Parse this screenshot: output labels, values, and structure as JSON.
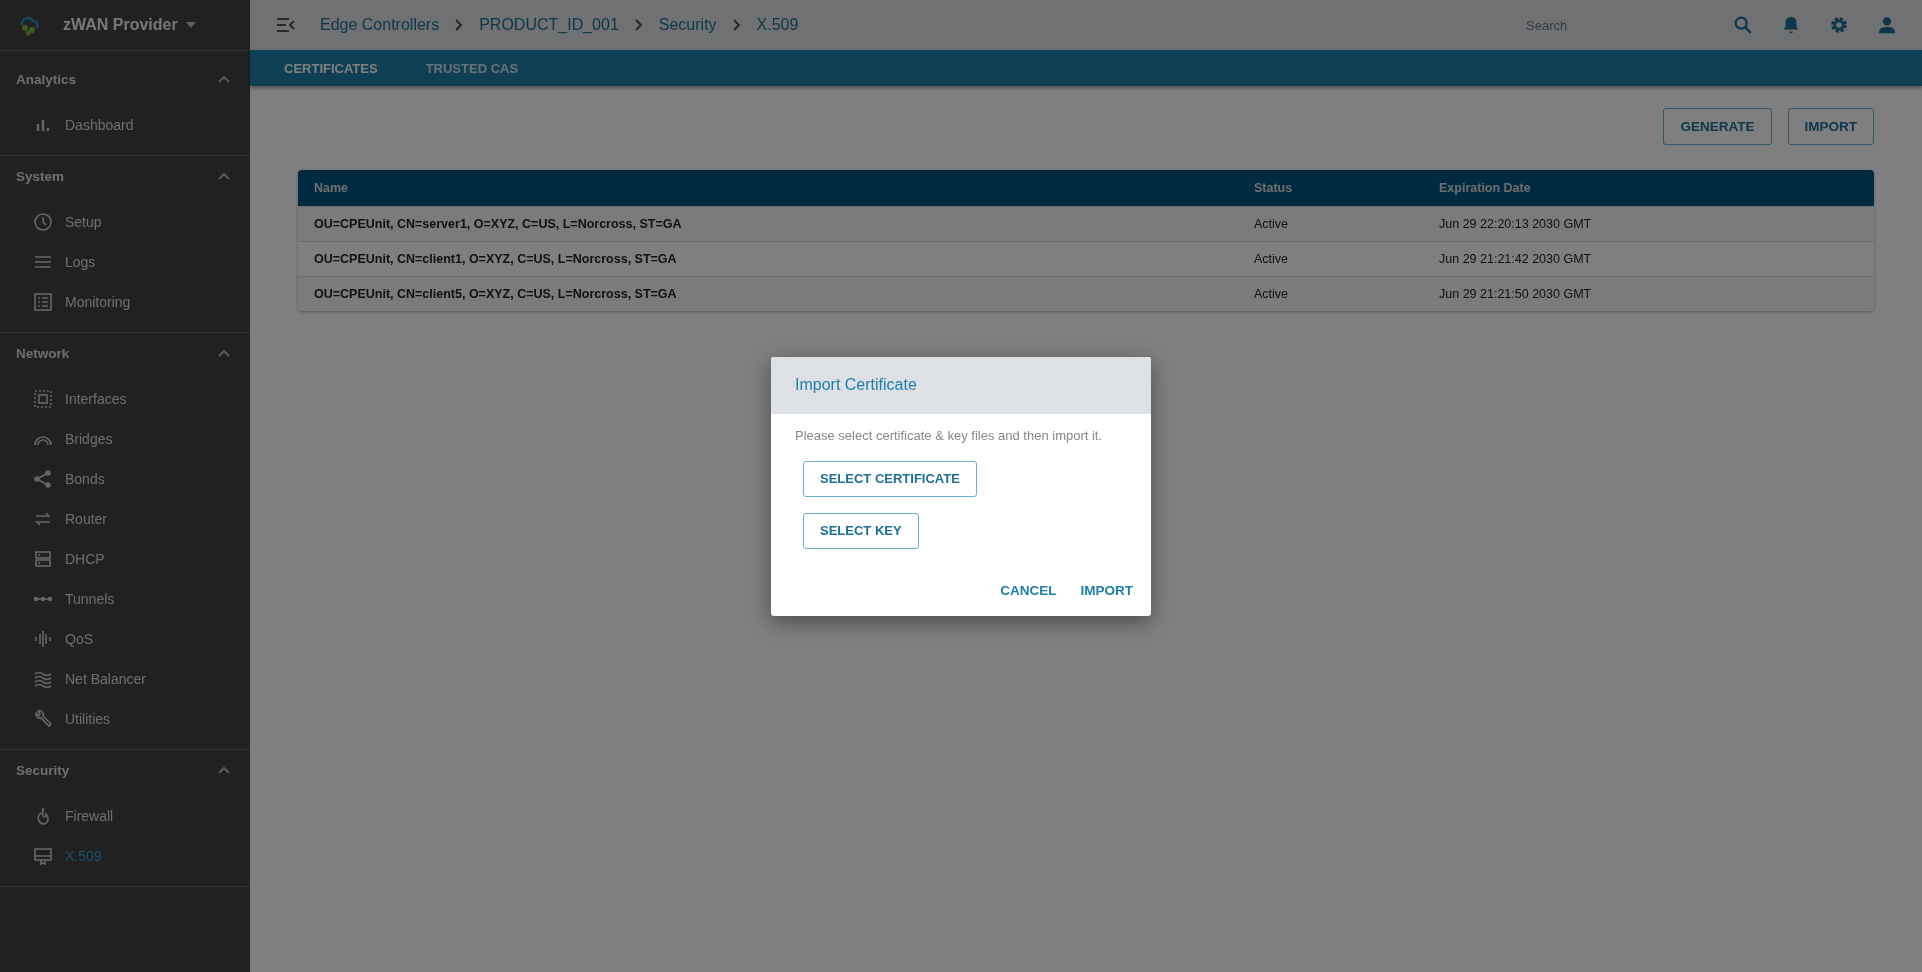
{
  "brand": {
    "name": "zWAN Provider"
  },
  "sidebar": {
    "sections": [
      {
        "title": "Analytics",
        "expanded": true,
        "items": [
          {
            "label": "Dashboard",
            "kind": "bars",
            "selected": false
          }
        ]
      },
      {
        "title": "System",
        "expanded": true,
        "items": [
          {
            "label": "Setup",
            "kind": "clock",
            "selected": false
          },
          {
            "label": "Logs",
            "kind": "lines",
            "selected": false
          },
          {
            "label": "Monitoring",
            "kind": "list",
            "selected": false
          }
        ]
      },
      {
        "title": "Network",
        "expanded": true,
        "items": [
          {
            "label": "Interfaces",
            "kind": "dotted",
            "selected": false
          },
          {
            "label": "Bridges",
            "kind": "arc",
            "selected": false
          },
          {
            "label": "Bonds",
            "kind": "share",
            "selected": false
          },
          {
            "label": "Router",
            "kind": "swap",
            "selected": false
          },
          {
            "label": "DHCP",
            "kind": "server",
            "selected": false
          },
          {
            "label": "Tunnels",
            "kind": "dots",
            "selected": false
          },
          {
            "label": "QoS",
            "kind": "wave",
            "selected": false
          },
          {
            "label": "Net Balancer",
            "kind": "waves",
            "selected": false
          },
          {
            "label": "Utilities",
            "kind": "wrench",
            "selected": false
          }
        ]
      },
      {
        "title": "Security",
        "expanded": true,
        "items": [
          {
            "label": "Firewall",
            "kind": "flame",
            "selected": false
          },
          {
            "label": "X.509",
            "kind": "cert",
            "selected": true
          }
        ]
      }
    ]
  },
  "breadcrumb": [
    "Edge Controllers",
    "PRODUCT_ID_001",
    "Security",
    "X.509"
  ],
  "search": {
    "placeholder": "Search"
  },
  "tabs": [
    {
      "label": "CERTIFICATES",
      "selected": true
    },
    {
      "label": "TRUSTED CAS",
      "selected": false
    }
  ],
  "actions": [
    "GENERATE",
    "IMPORT"
  ],
  "table": {
    "columns": [
      "Name",
      "Status",
      "Expiration Date"
    ],
    "rows": [
      [
        "OU=CPEUnit, CN=server1, O=XYZ, C=US, L=Norcross, ST=GA",
        "Active",
        "Jun 29 22:20:13 2030 GMT"
      ],
      [
        "OU=CPEUnit, CN=client1, O=XYZ, C=US, L=Norcross, ST=GA",
        "Active",
        "Jun 29 21:21:42 2030 GMT"
      ],
      [
        "OU=CPEUnit, CN=client5, O=XYZ, C=US, L=Norcross, ST=GA",
        "Active",
        "Jun 29 21:21:50 2030 GMT"
      ]
    ]
  },
  "dialog": {
    "title": "Import Certificate",
    "message": "Please select certificate & key files and then import it.",
    "file_buttons": [
      "SELECT CERTIFICATE",
      "SELECT KEY"
    ],
    "buttons": [
      "CANCEL",
      "IMPORT"
    ]
  }
}
